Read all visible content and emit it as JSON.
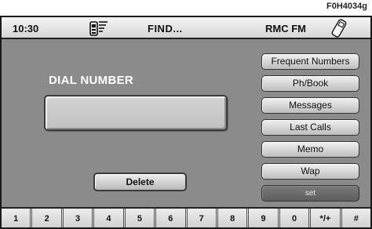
{
  "figure_code": "F0H4034g",
  "status_bar": {
    "clock": "10:30",
    "signal_icon": "phone-signal-icon",
    "mode": "FIND...",
    "radio_station": "RMC FM",
    "phone_icon": "mobile-phone-icon"
  },
  "main": {
    "title": "DIAL NUMBER",
    "number_value": "",
    "delete_label": "Delete"
  },
  "menu": {
    "items": [
      {
        "label": "Frequent Numbers"
      },
      {
        "label": "Ph/Book"
      },
      {
        "label": "Messages"
      },
      {
        "label": "Last Calls"
      },
      {
        "label": "Memo"
      },
      {
        "label": "Wap"
      },
      {
        "label": "set",
        "selected": true
      }
    ]
  },
  "keypad": {
    "keys": [
      "1",
      "2",
      "3",
      "4",
      "5",
      "6",
      "7",
      "8",
      "9",
      "0",
      "*/+",
      "#"
    ]
  },
  "colors": {
    "screen_bg": "#8b8b8b",
    "bar_bg": "#e6e6e6",
    "selected_item": "#6a6a6a"
  }
}
